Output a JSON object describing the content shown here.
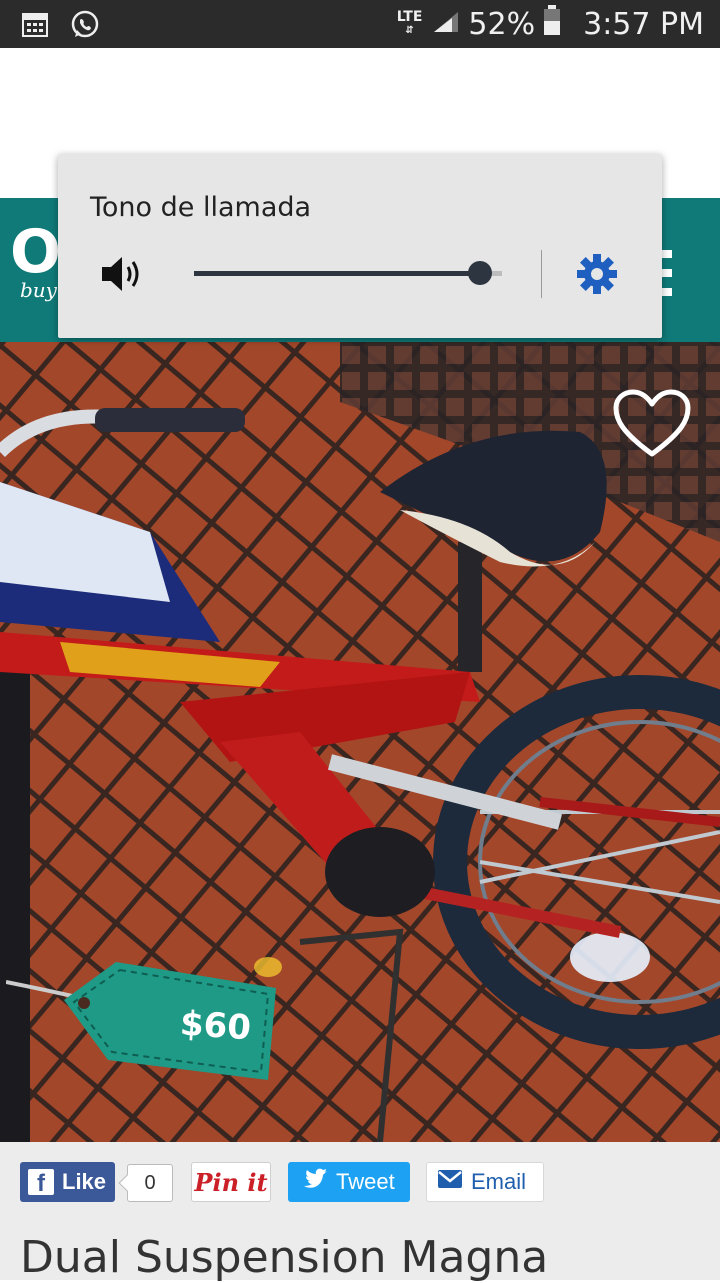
{
  "status_bar": {
    "network": "LTE",
    "battery": "52%",
    "time": "3:57 PM",
    "icons": [
      "calendar-icon",
      "whatsapp-icon",
      "signal-icon",
      "battery-icon"
    ]
  },
  "volume_panel": {
    "title": "Tono de llamada",
    "level_fraction": 0.93,
    "icons": [
      "speaker-icon",
      "settings-gear-icon"
    ],
    "accent_color": "#1f5fbf"
  },
  "brand": {
    "logo_text": "O",
    "tagline": "buy",
    "bar_color": "#0f7a78"
  },
  "listing": {
    "price": "$60",
    "price_tag_color": "#1f9a86",
    "favorite_icon": "heart-outline-icon",
    "title": "Dual Suspension Magna"
  },
  "share": {
    "facebook": {
      "label": "Like",
      "count": "0"
    },
    "pinterest": {
      "label": "Pin it"
    },
    "twitter": {
      "label": "Tweet"
    },
    "email": {
      "label": "Email"
    }
  }
}
